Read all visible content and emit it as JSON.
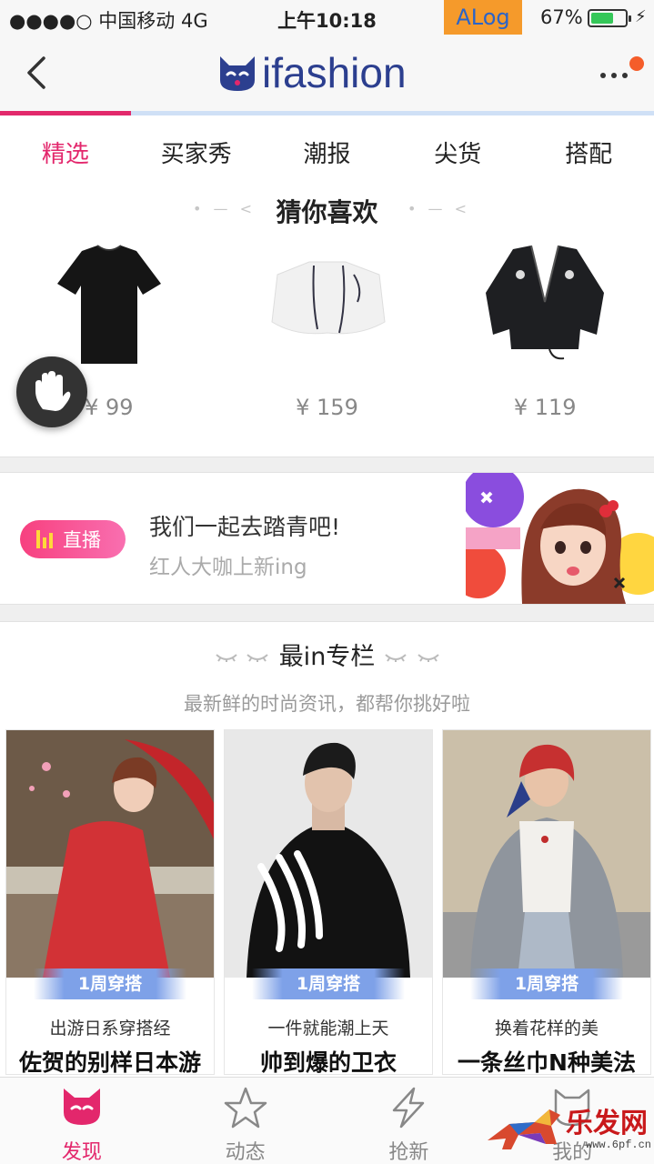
{
  "status_bar": {
    "carrier": "●●●●○ 中国移动  4G",
    "time": "上午10:18",
    "alog": "ALog",
    "battery_percent": "67%",
    "battery_level": 0.67
  },
  "nav": {
    "logo_text": "ifashion",
    "progress": 0.2,
    "colors": {
      "brand": "#2c3f8f",
      "accent": "#e3276c"
    }
  },
  "tabs": [
    {
      "label": "精选",
      "active": true
    },
    {
      "label": "买家秀",
      "active": false
    },
    {
      "label": "潮报",
      "active": false
    },
    {
      "label": "尖货",
      "active": false
    },
    {
      "label": "搭配",
      "active": false
    }
  ],
  "guess": {
    "title": "猜你喜欢",
    "products": [
      {
        "icon": "black-tshirt",
        "price": "¥ 99"
      },
      {
        "icon": "white-shirt",
        "price": "¥ 159"
      },
      {
        "icon": "black-jacket",
        "price": "¥ 119"
      }
    ]
  },
  "live": {
    "badge": "直播",
    "headline": "我们一起去踏青吧!",
    "subline": "红人大咖上新ing"
  },
  "column": {
    "title": "最in专栏",
    "subtitle": "最新鲜的时尚资讯，都帮你挑好啦",
    "cards": [
      {
        "ribbon": "1周穿搭",
        "kicker": "出游日系穿搭经",
        "title": "佐贺的别样日本游"
      },
      {
        "ribbon": "1周穿搭",
        "kicker": "一件就能潮上天",
        "title": "帅到爆的卫衣"
      },
      {
        "ribbon": "1周穿搭",
        "kicker": "换着花样的美",
        "title": "一条丝巾N种美法"
      }
    ]
  },
  "tabbar": [
    {
      "label": "发现",
      "icon": "discover-icon",
      "active": true
    },
    {
      "label": "动态",
      "icon": "feed-icon",
      "active": false
    },
    {
      "label": "抢新",
      "icon": "flash-icon",
      "active": false
    },
    {
      "label": "我的",
      "icon": "profile-icon",
      "active": false
    }
  ],
  "watermark": {
    "text": "乐发网",
    "url": "www.6pf.cn"
  }
}
